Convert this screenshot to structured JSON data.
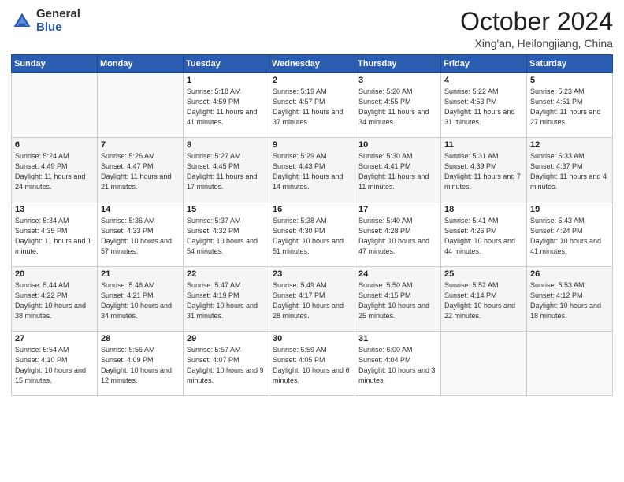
{
  "logo": {
    "general": "General",
    "blue": "Blue"
  },
  "header": {
    "month": "October 2024",
    "location": "Xing'an, Heilongjiang, China"
  },
  "weekdays": [
    "Sunday",
    "Monday",
    "Tuesday",
    "Wednesday",
    "Thursday",
    "Friday",
    "Saturday"
  ],
  "rows": [
    [
      {
        "day": "",
        "sunrise": "",
        "sunset": "",
        "daylight": ""
      },
      {
        "day": "",
        "sunrise": "",
        "sunset": "",
        "daylight": ""
      },
      {
        "day": "1",
        "sunrise": "Sunrise: 5:18 AM",
        "sunset": "Sunset: 4:59 PM",
        "daylight": "Daylight: 11 hours and 41 minutes."
      },
      {
        "day": "2",
        "sunrise": "Sunrise: 5:19 AM",
        "sunset": "Sunset: 4:57 PM",
        "daylight": "Daylight: 11 hours and 37 minutes."
      },
      {
        "day": "3",
        "sunrise": "Sunrise: 5:20 AM",
        "sunset": "Sunset: 4:55 PM",
        "daylight": "Daylight: 11 hours and 34 minutes."
      },
      {
        "day": "4",
        "sunrise": "Sunrise: 5:22 AM",
        "sunset": "Sunset: 4:53 PM",
        "daylight": "Daylight: 11 hours and 31 minutes."
      },
      {
        "day": "5",
        "sunrise": "Sunrise: 5:23 AM",
        "sunset": "Sunset: 4:51 PM",
        "daylight": "Daylight: 11 hours and 27 minutes."
      }
    ],
    [
      {
        "day": "6",
        "sunrise": "Sunrise: 5:24 AM",
        "sunset": "Sunset: 4:49 PM",
        "daylight": "Daylight: 11 hours and 24 minutes."
      },
      {
        "day": "7",
        "sunrise": "Sunrise: 5:26 AM",
        "sunset": "Sunset: 4:47 PM",
        "daylight": "Daylight: 11 hours and 21 minutes."
      },
      {
        "day": "8",
        "sunrise": "Sunrise: 5:27 AM",
        "sunset": "Sunset: 4:45 PM",
        "daylight": "Daylight: 11 hours and 17 minutes."
      },
      {
        "day": "9",
        "sunrise": "Sunrise: 5:29 AM",
        "sunset": "Sunset: 4:43 PM",
        "daylight": "Daylight: 11 hours and 14 minutes."
      },
      {
        "day": "10",
        "sunrise": "Sunrise: 5:30 AM",
        "sunset": "Sunset: 4:41 PM",
        "daylight": "Daylight: 11 hours and 11 minutes."
      },
      {
        "day": "11",
        "sunrise": "Sunrise: 5:31 AM",
        "sunset": "Sunset: 4:39 PM",
        "daylight": "Daylight: 11 hours and 7 minutes."
      },
      {
        "day": "12",
        "sunrise": "Sunrise: 5:33 AM",
        "sunset": "Sunset: 4:37 PM",
        "daylight": "Daylight: 11 hours and 4 minutes."
      }
    ],
    [
      {
        "day": "13",
        "sunrise": "Sunrise: 5:34 AM",
        "sunset": "Sunset: 4:35 PM",
        "daylight": "Daylight: 11 hours and 1 minute."
      },
      {
        "day": "14",
        "sunrise": "Sunrise: 5:36 AM",
        "sunset": "Sunset: 4:33 PM",
        "daylight": "Daylight: 10 hours and 57 minutes."
      },
      {
        "day": "15",
        "sunrise": "Sunrise: 5:37 AM",
        "sunset": "Sunset: 4:32 PM",
        "daylight": "Daylight: 10 hours and 54 minutes."
      },
      {
        "day": "16",
        "sunrise": "Sunrise: 5:38 AM",
        "sunset": "Sunset: 4:30 PM",
        "daylight": "Daylight: 10 hours and 51 minutes."
      },
      {
        "day": "17",
        "sunrise": "Sunrise: 5:40 AM",
        "sunset": "Sunset: 4:28 PM",
        "daylight": "Daylight: 10 hours and 47 minutes."
      },
      {
        "day": "18",
        "sunrise": "Sunrise: 5:41 AM",
        "sunset": "Sunset: 4:26 PM",
        "daylight": "Daylight: 10 hours and 44 minutes."
      },
      {
        "day": "19",
        "sunrise": "Sunrise: 5:43 AM",
        "sunset": "Sunset: 4:24 PM",
        "daylight": "Daylight: 10 hours and 41 minutes."
      }
    ],
    [
      {
        "day": "20",
        "sunrise": "Sunrise: 5:44 AM",
        "sunset": "Sunset: 4:22 PM",
        "daylight": "Daylight: 10 hours and 38 minutes."
      },
      {
        "day": "21",
        "sunrise": "Sunrise: 5:46 AM",
        "sunset": "Sunset: 4:21 PM",
        "daylight": "Daylight: 10 hours and 34 minutes."
      },
      {
        "day": "22",
        "sunrise": "Sunrise: 5:47 AM",
        "sunset": "Sunset: 4:19 PM",
        "daylight": "Daylight: 10 hours and 31 minutes."
      },
      {
        "day": "23",
        "sunrise": "Sunrise: 5:49 AM",
        "sunset": "Sunset: 4:17 PM",
        "daylight": "Daylight: 10 hours and 28 minutes."
      },
      {
        "day": "24",
        "sunrise": "Sunrise: 5:50 AM",
        "sunset": "Sunset: 4:15 PM",
        "daylight": "Daylight: 10 hours and 25 minutes."
      },
      {
        "day": "25",
        "sunrise": "Sunrise: 5:52 AM",
        "sunset": "Sunset: 4:14 PM",
        "daylight": "Daylight: 10 hours and 22 minutes."
      },
      {
        "day": "26",
        "sunrise": "Sunrise: 5:53 AM",
        "sunset": "Sunset: 4:12 PM",
        "daylight": "Daylight: 10 hours and 18 minutes."
      }
    ],
    [
      {
        "day": "27",
        "sunrise": "Sunrise: 5:54 AM",
        "sunset": "Sunset: 4:10 PM",
        "daylight": "Daylight: 10 hours and 15 minutes."
      },
      {
        "day": "28",
        "sunrise": "Sunrise: 5:56 AM",
        "sunset": "Sunset: 4:09 PM",
        "daylight": "Daylight: 10 hours and 12 minutes."
      },
      {
        "day": "29",
        "sunrise": "Sunrise: 5:57 AM",
        "sunset": "Sunset: 4:07 PM",
        "daylight": "Daylight: 10 hours and 9 minutes."
      },
      {
        "day": "30",
        "sunrise": "Sunrise: 5:59 AM",
        "sunset": "Sunset: 4:05 PM",
        "daylight": "Daylight: 10 hours and 6 minutes."
      },
      {
        "day": "31",
        "sunrise": "Sunrise: 6:00 AM",
        "sunset": "Sunset: 4:04 PM",
        "daylight": "Daylight: 10 hours and 3 minutes."
      },
      {
        "day": "",
        "sunrise": "",
        "sunset": "",
        "daylight": ""
      },
      {
        "day": "",
        "sunrise": "",
        "sunset": "",
        "daylight": ""
      }
    ]
  ]
}
